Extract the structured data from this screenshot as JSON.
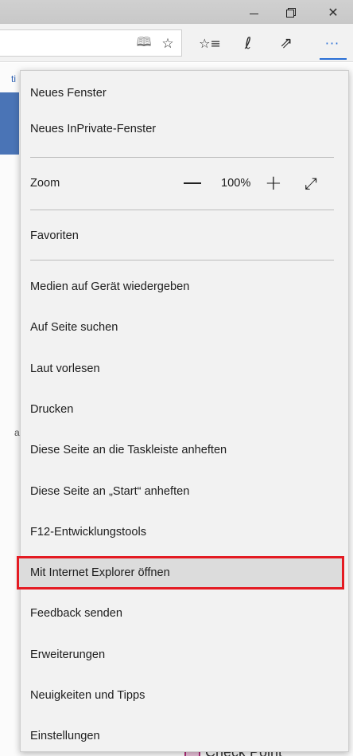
{
  "window": {
    "minimize_glyph": "–",
    "close_glyph": "✕"
  },
  "toolbar": {
    "reading_view_icon": "book-open-icon",
    "reading_view_glyph": "🕮",
    "favorite_glyph": "☆",
    "favorites_hub_glyph": "☆≡",
    "notes_glyph": "ℓ",
    "share_glyph": "⇗",
    "more_glyph": "···"
  },
  "page_behind": {
    "peek_text_top": "ti",
    "peek_text_mid": "a",
    "brand_text": "Check Point"
  },
  "menu": {
    "new_window": "Neues Fenster",
    "new_inprivate": "Neues InPrivate-Fenster",
    "zoom": {
      "label": "Zoom",
      "minus_glyph": "—",
      "value": "100%",
      "plus_glyph": "+",
      "fullscreen_glyph": "⤢"
    },
    "favorites": "Favoriten",
    "items": [
      {
        "id": "cast",
        "label": "Medien auf Gerät wiedergeben"
      },
      {
        "id": "find",
        "label": "Auf Seite suchen"
      },
      {
        "id": "read-aloud",
        "label": "Laut vorlesen"
      },
      {
        "id": "print",
        "label": "Drucken"
      },
      {
        "id": "pin-taskbar",
        "label": "Diese Seite an die Taskleiste anheften"
      },
      {
        "id": "pin-start",
        "label": "Diese Seite an „Start“ anheften"
      },
      {
        "id": "devtools",
        "label": "F12-Entwicklungstools"
      },
      {
        "id": "open-ie",
        "label": "Mit Internet Explorer öffnen",
        "highlighted": true
      },
      {
        "id": "feedback",
        "label": "Feedback senden"
      },
      {
        "id": "extensions",
        "label": "Erweiterungen"
      },
      {
        "id": "news-tips",
        "label": "Neuigkeiten und Tipps"
      },
      {
        "id": "settings",
        "label": "Einstellungen"
      }
    ]
  },
  "colors": {
    "highlight_border": "#e41b23",
    "accent": "#2a6fd6",
    "menu_bg": "#f2f2f2"
  }
}
